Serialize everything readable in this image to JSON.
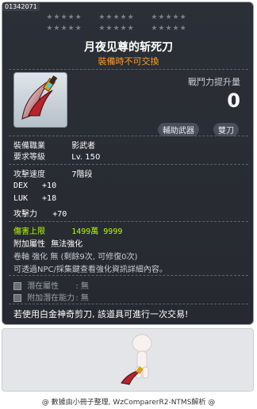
{
  "item_id": "01342071",
  "stars": [
    "★★★★★",
    "★★★★★",
    "★★★★★",
    "★★★★★",
    "★★★★★",
    "★★★★★",
    "★★★★★",
    "★★★★★"
  ],
  "title": "月夜见尊的斩死刀",
  "subtitle": "裝備時不可交換",
  "power": {
    "label": "戰鬥力提升量",
    "value": "0"
  },
  "tags": [
    "輔助武器",
    "雙刀"
  ],
  "job": {
    "label": "裝備職業",
    "value": "影武者"
  },
  "level": {
    "label": "要求等級",
    "value": "Lv. 150"
  },
  "speed": {
    "label": "攻擊速度",
    "value": "7階段"
  },
  "stats": [
    {
      "label": "DEX",
      "value": "+10"
    },
    {
      "label": "LUK",
      "value": "+18"
    },
    {
      "label": "攻擊力",
      "value": "+70"
    }
  ],
  "damage_cap": {
    "label": "傷害上限",
    "value": "1499萬 9999"
  },
  "extra": {
    "label": "附加屬性",
    "value": "無法強化",
    "scroll_line": "卷軸 強化 無 (剩餘9次, 可修復0次)",
    "npc_line": "可透過NPC/採集鍵查看強化資訊詳細內容。"
  },
  "potential": {
    "label": "潛在屬性",
    "value": ": 無"
  },
  "add_potential": {
    "label": "附加潛在能力",
    "value": ": 無"
  },
  "notice": "若使用白金神奇剪刀, 該道具可進行一次交易!",
  "footer": "@ 數據由小冊子整理, WzComparerR2-NTMS解析 @",
  "colors": {
    "accent_orange": "#ff9c2b",
    "highlight_green": "#b6ff00",
    "panel_bg": "#2b2f36"
  }
}
